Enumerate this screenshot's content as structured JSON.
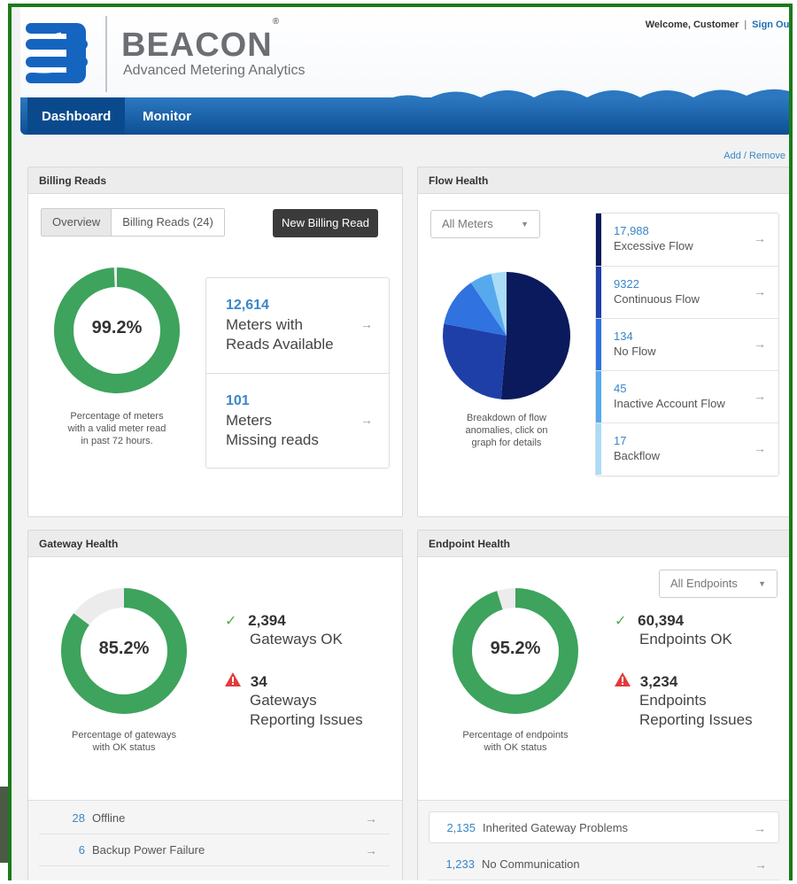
{
  "header": {
    "brand": "BEACON",
    "brand_mark": "®",
    "tagline": "Advanced Metering Analytics",
    "welcome": "Welcome, Customer",
    "separator": "|",
    "sign_out": "Sign Out"
  },
  "nav": {
    "dashboard": "Dashboard",
    "monitor": "Monitor"
  },
  "add_remove": "Add / Remove",
  "billing": {
    "title": "Billing Reads",
    "tab_overview": "Overview",
    "tab_billing_reads": "Billing Reads (24)",
    "new_button": "New Billing Read",
    "percent": "99.2%",
    "percent_value": 0.992,
    "caption_1": "Percentage of meters",
    "caption_2": "with a valid meter read",
    "caption_3": "in past 72 hours.",
    "stat1_num": "12,614",
    "stat1_l1": "Meters with",
    "stat1_l2": "Reads Available",
    "stat2_num": "101",
    "stat2_l1": "Meters",
    "stat2_l2": "Missing reads"
  },
  "flow": {
    "title": "Flow Health",
    "select": "All Meters",
    "caption_1": "Breakdown of flow",
    "caption_2": "anomalies, click on",
    "caption_3": "graph for details",
    "items": [
      {
        "value": "17,988",
        "label": "Excessive Flow",
        "color": "#0b1a5c"
      },
      {
        "value": "9322",
        "label": "Continuous Flow",
        "color": "#1f3fa8"
      },
      {
        "value": "134",
        "label": "No Flow",
        "color": "#2f72e0"
      },
      {
        "value": "45",
        "label": "Inactive Account Flow",
        "color": "#57a9ee"
      },
      {
        "value": "17",
        "label": "Backflow",
        "color": "#a9dcf6"
      }
    ]
  },
  "gateway": {
    "title": "Gateway Health",
    "percent": "85.2%",
    "percent_value": 0.852,
    "caption_1": "Percentage of gateways",
    "caption_2": "with OK status",
    "ok_num": "2,394",
    "ok_lbl": "Gateways OK",
    "issue_num": "34",
    "issue_l1": "Gateways",
    "issue_l2": "Reporting Issues",
    "foot": [
      {
        "num": "28",
        "label": "Offline"
      },
      {
        "num": "6",
        "label": "Backup Power Failure"
      }
    ]
  },
  "endpoint": {
    "title": "Endpoint Health",
    "select": "All Endpoints",
    "percent": "95.2%",
    "percent_value": 0.952,
    "caption_1": "Percentage of endpoints",
    "caption_2": "with OK status",
    "ok_num": "60,394",
    "ok_lbl": "Endpoints OK",
    "issue_num": "3,234",
    "issue_l1": "Endpoints",
    "issue_l2": "Reporting Issues",
    "foot": [
      {
        "num": "2,135",
        "label": "Inherited Gateway Problems"
      },
      {
        "num": "1,233",
        "label": "No Communication"
      }
    ]
  },
  "colors": {
    "ok_green": "#3da35d",
    "track_gray": "#ececec",
    "accent_blue": "#3a86c8",
    "nav_blue": "#0d4f94",
    "warn_red": "#e23b3b"
  }
}
